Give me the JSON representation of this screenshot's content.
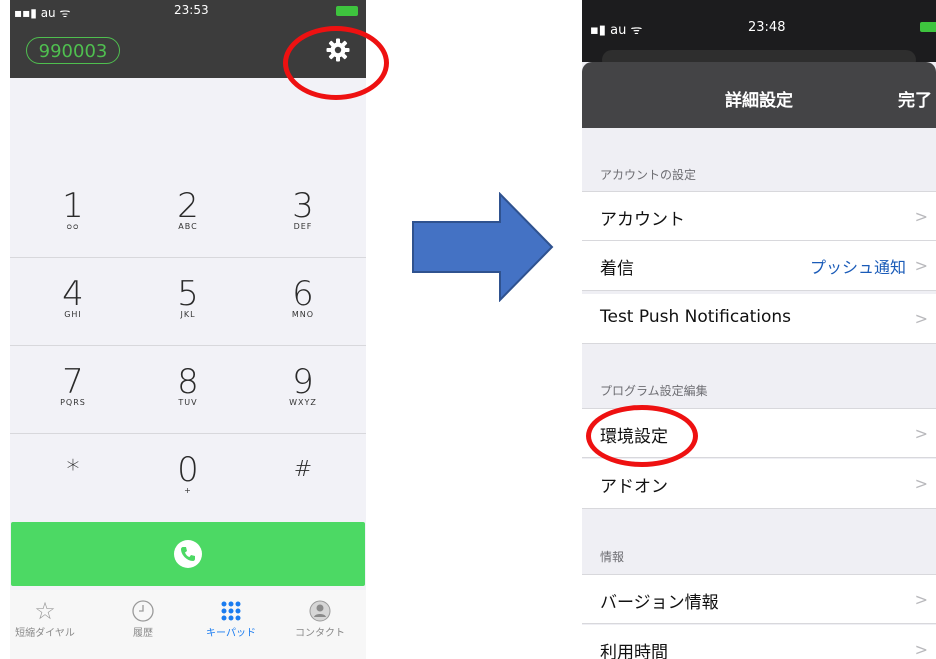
{
  "left_phone": {
    "status": {
      "carrier": "au",
      "time": "23:53"
    },
    "account_number": "990003",
    "keys": [
      {
        "digit": "1",
        "letters": ""
      },
      {
        "digit": "2",
        "letters": "ABC"
      },
      {
        "digit": "3",
        "letters": "DEF"
      },
      {
        "digit": "4",
        "letters": "GHI"
      },
      {
        "digit": "5",
        "letters": "JKL"
      },
      {
        "digit": "6",
        "letters": "MNO"
      },
      {
        "digit": "7",
        "letters": "PQRS"
      },
      {
        "digit": "8",
        "letters": "TUV"
      },
      {
        "digit": "9",
        "letters": "WXYZ"
      },
      {
        "digit": "*",
        "letters": ""
      },
      {
        "digit": "0",
        "letters": "+"
      },
      {
        "digit": "#",
        "letters": ""
      }
    ],
    "tabs": [
      {
        "label": "短縮ダイヤル",
        "icon": "star-icon"
      },
      {
        "label": "履歴",
        "icon": "clock-icon"
      },
      {
        "label": "キーパッド",
        "icon": "keypad-icon",
        "active": true
      },
      {
        "label": "コンタクト",
        "icon": "contact-icon"
      }
    ],
    "colors": {
      "call": "#4cd964",
      "accent_green": "#4fbf4f",
      "active_tab": "#1a7cf0",
      "highlight": "#ee1111"
    }
  },
  "right_phone": {
    "status": {
      "carrier": "au",
      "time": "23:48"
    },
    "nav": {
      "title": "詳細設定",
      "done": "完了"
    },
    "sections": [
      {
        "header": "アカウントの設定",
        "rows": [
          {
            "label": "アカウント",
            "value": ""
          },
          {
            "label": "着信",
            "value": "プッシュ通知"
          },
          {
            "label": "Test Push Notifications",
            "value": ""
          }
        ]
      },
      {
        "header": "プログラム設定編集",
        "rows": [
          {
            "label": "環境設定",
            "value": ""
          },
          {
            "label": "アドオン",
            "value": ""
          }
        ]
      },
      {
        "header": "情報",
        "rows": [
          {
            "label": "バージョン情報",
            "value": ""
          },
          {
            "label": "利用時間",
            "value": ""
          }
        ]
      }
    ],
    "chevron": ">"
  }
}
